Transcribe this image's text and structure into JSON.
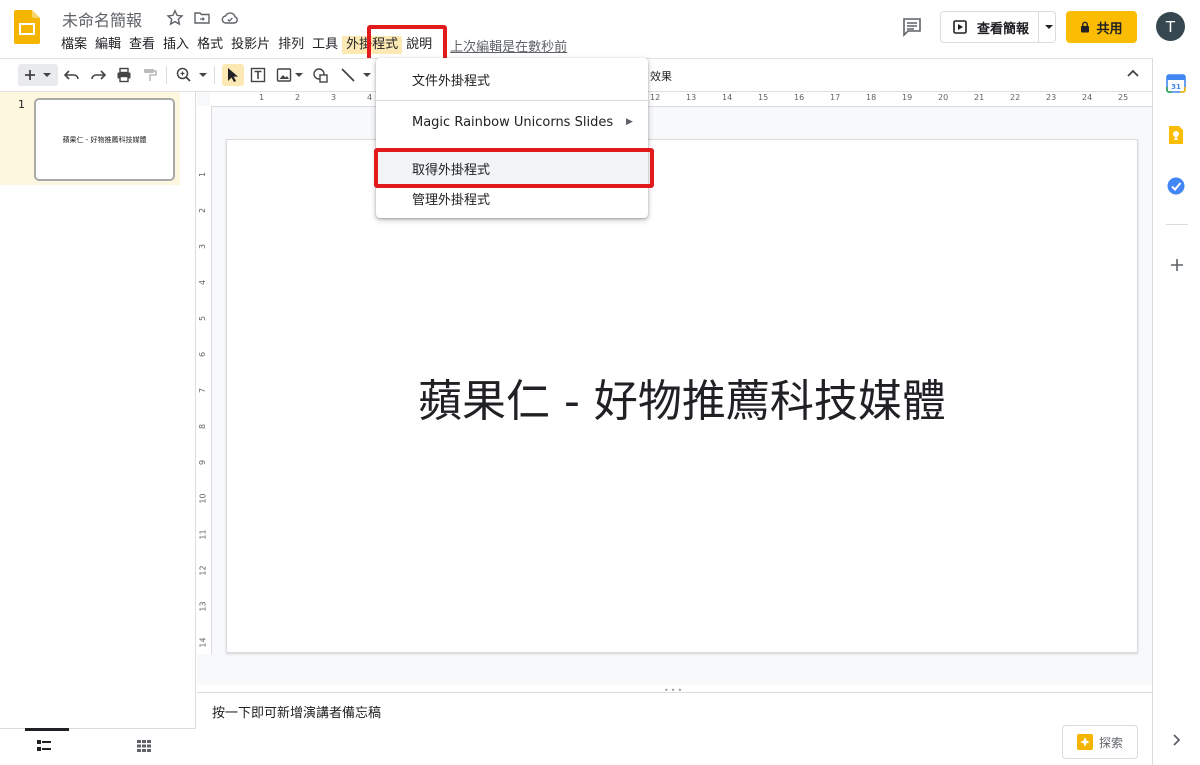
{
  "header": {
    "doc_title": "未命名簡報",
    "menus": [
      "檔案",
      "編輯",
      "查看",
      "插入",
      "格式",
      "投影片",
      "排列",
      "工具",
      "外掛程式",
      "說明"
    ],
    "last_edit": "上次編輯是在數秒前",
    "present_label": "查看簡報",
    "share_label": "共用",
    "avatar_letter": "T"
  },
  "toolbar": {
    "effects_label": "效果"
  },
  "filmstrip": {
    "slides": [
      {
        "number": "1",
        "title": "蘋果仁 - 好物推薦科技媒體"
      }
    ]
  },
  "ruler": {
    "h_labels": [
      "1",
      "2",
      "3",
      "4",
      "12",
      "13",
      "14",
      "15",
      "16",
      "17",
      "18",
      "19",
      "20",
      "21",
      "22",
      "23",
      "24",
      "25"
    ],
    "v_labels": [
      "1",
      "2",
      "3",
      "4",
      "5",
      "6",
      "7",
      "8",
      "9",
      "10",
      "11",
      "12",
      "13",
      "14"
    ]
  },
  "slide": {
    "title": "蘋果仁 - 好物推薦科技媒體"
  },
  "notes": {
    "placeholder": "按一下即可新增演講者備忘稿"
  },
  "explore": {
    "label": "探索"
  },
  "addons_menu": {
    "items": [
      "文件外掛程式",
      "Magic Rainbow Unicorns Slides",
      "取得外掛程式",
      "管理外掛程式"
    ]
  },
  "colors": {
    "highlight_red": "#e31a1c",
    "share_yellow": "#fbbc04",
    "menu_active_bg": "#fce8b2"
  }
}
